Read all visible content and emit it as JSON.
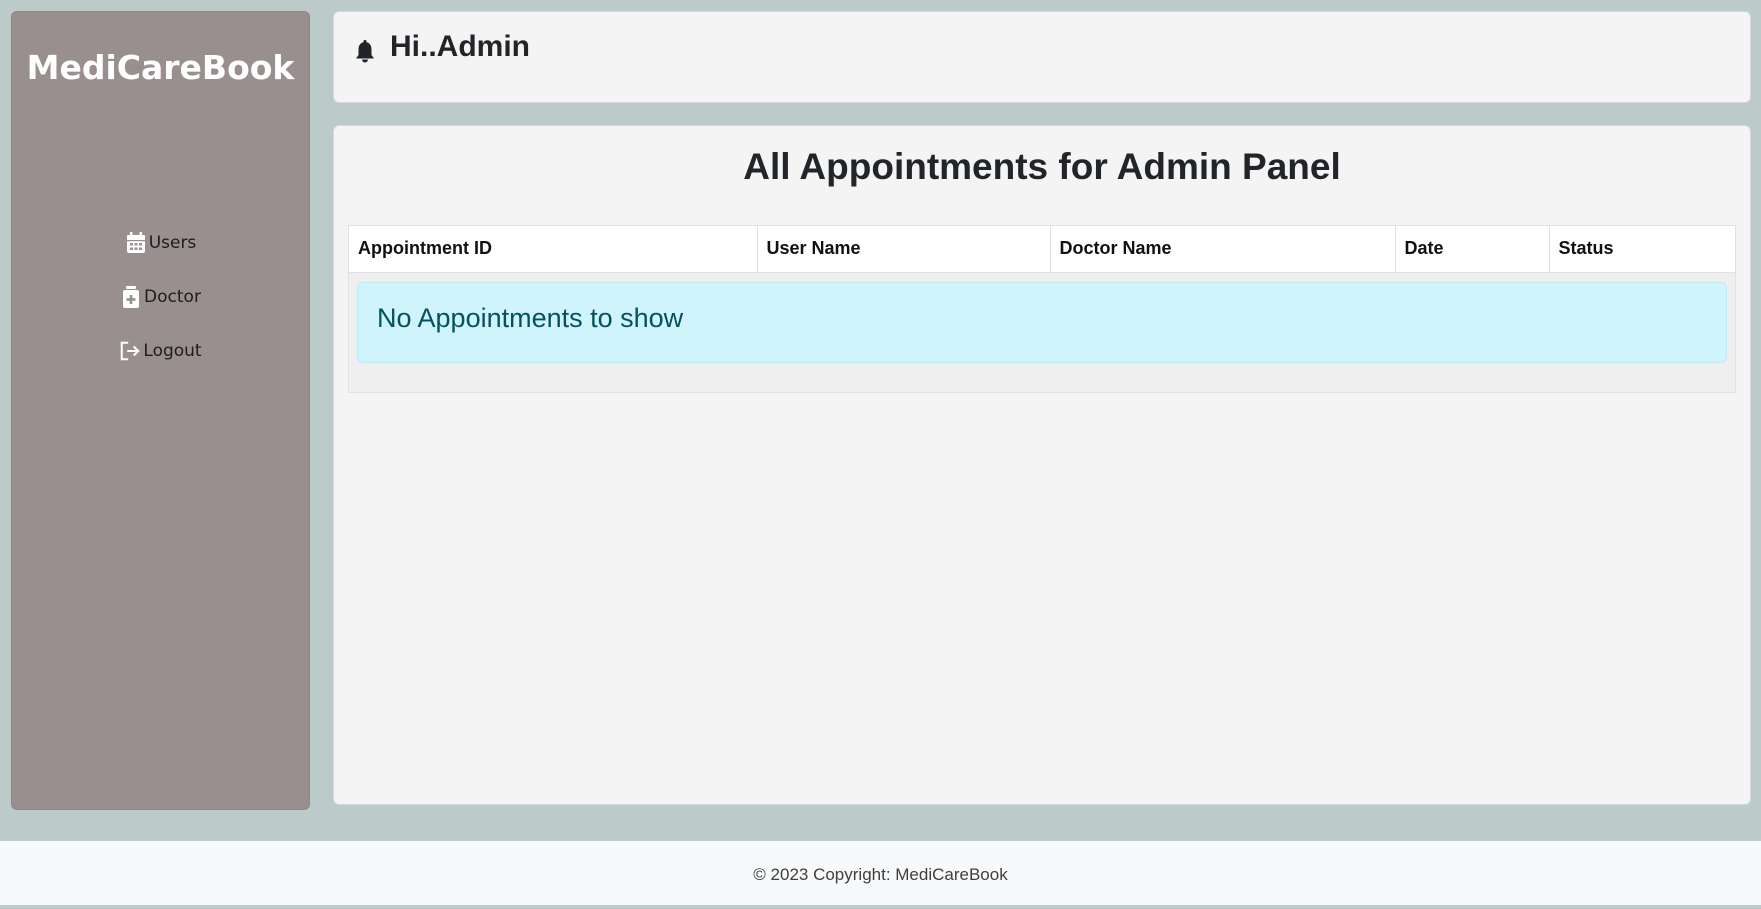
{
  "sidebar": {
    "brand": "MediCareBook",
    "items": [
      {
        "label": "Users",
        "icon": "calendar-icon"
      },
      {
        "label": "Doctor",
        "icon": "medical-file-icon"
      },
      {
        "label": "Logout",
        "icon": "logout-icon"
      }
    ]
  },
  "header": {
    "greeting": "Hi..Admin",
    "icon": "bell-icon"
  },
  "main": {
    "title": "All Appointments for Admin Panel",
    "table": {
      "columns": [
        "Appointment ID",
        "User Name",
        "Doctor Name",
        "Date",
        "Status"
      ],
      "rows": []
    },
    "empty_message": "No Appointments to show"
  },
  "footer": {
    "text": "© 2023 Copyright: MediCareBook"
  },
  "colors": {
    "page_bg": "#bdcaca",
    "sidebar_bg": "#998f8f",
    "card_bg": "#f4f4f4",
    "alert_bg": "#cff4fc",
    "alert_text": "#055160"
  }
}
